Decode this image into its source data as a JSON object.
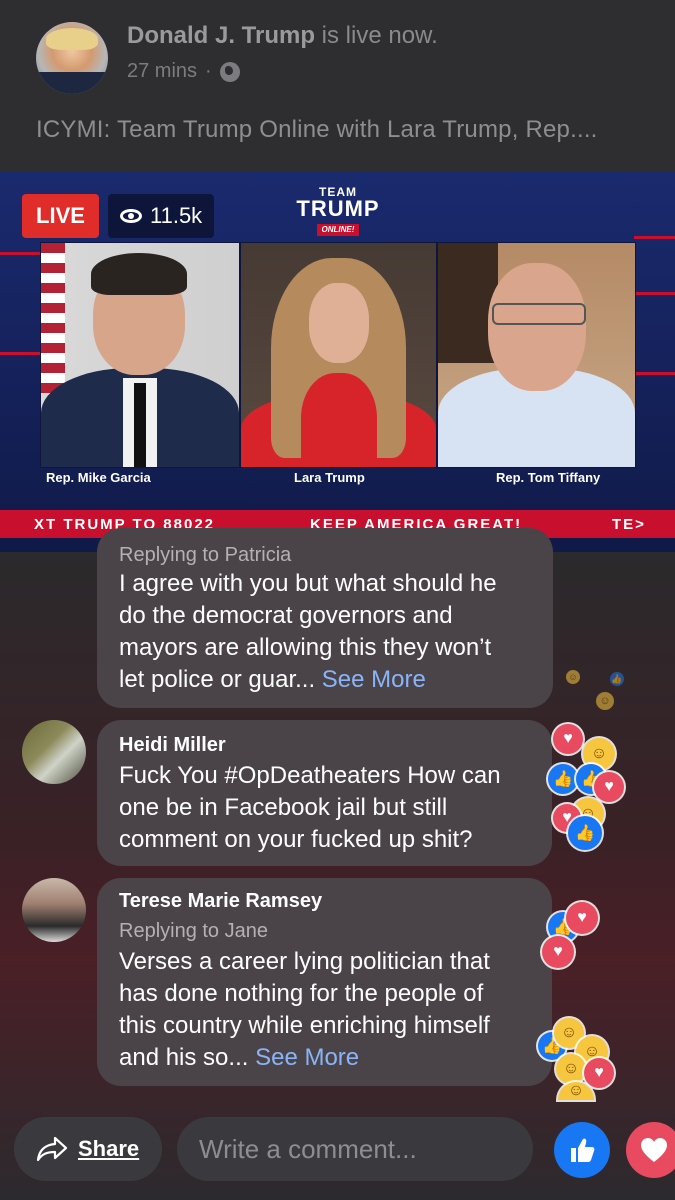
{
  "post": {
    "author": "Donald J. Trump",
    "status": " is live now.",
    "time": "27 mins",
    "separator": "·",
    "text": "ICYMI: Team Trump Online with Lara Trump, Rep...."
  },
  "video": {
    "live_label": "LIVE",
    "viewers": "11.5k",
    "logo": {
      "line1": "TEAM",
      "line2": "TRUMP",
      "line3": "ONLINE!"
    },
    "speakers": [
      "Rep. Mike Garcia",
      "Lara Trump",
      "Rep. Tom Tiffany"
    ],
    "ticker": {
      "left": "XT TRUMP TO 88022",
      "center": "KEEP AMERICA GREAT!",
      "right": "TE>"
    }
  },
  "comments": [
    {
      "name": "",
      "reply_to": "Replying to Patricia",
      "lines": [
        "I agree with you but what should he",
        "do the democrat governors and",
        "mayors are allowing this they won’t",
        "let police or guar..."
      ],
      "see_more": "See More"
    },
    {
      "name": "Heidi Miller",
      "reply_to": "",
      "lines": [
        "Fuck You #OpDeatheaters How can",
        "one be in Facebook jail but still",
        "comment on your fucked up shit?"
      ],
      "see_more": ""
    },
    {
      "name": "Terese Marie Ramsey",
      "reply_to": "Replying to Jane",
      "lines": [
        "Verses a career lying politician that",
        "has done nothing for the people of",
        "this country while enriching himself",
        "and his so..."
      ],
      "see_more": "See More"
    }
  ],
  "bottom": {
    "share_label": "Share",
    "comment_placeholder": "Write a comment..."
  },
  "icons": {
    "globe": "globe-icon",
    "eye": "eye-icon",
    "share": "share-arrow-icon",
    "like": "thumbs-up-icon",
    "love": "heart-icon",
    "haha": "laughing-face-icon"
  },
  "colors": {
    "live_red": "#e02d2a",
    "like_blue": "#1877f2",
    "love_red": "#e84a5f",
    "link_blue": "#8ab4f8",
    "bubble_bg": "#4a4448"
  }
}
